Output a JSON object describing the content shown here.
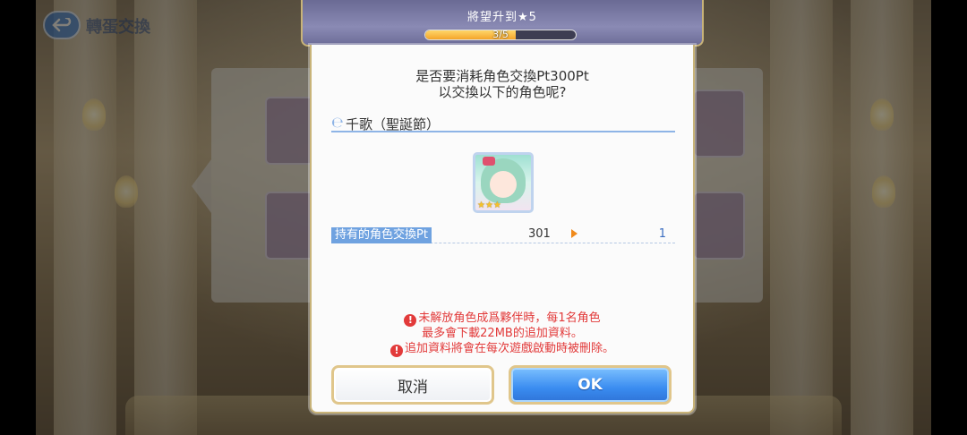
{
  "header": {
    "title": "將望升到★5",
    "progress_text": "3/5",
    "progress_value": 0.6
  },
  "background": {
    "screen_title": "轉蛋交換"
  },
  "dialog": {
    "question_line1": "是否要消耗角色交換Pt300Pt",
    "question_line2": "以交換以下的角色呢?",
    "character_name": "千歌（聖誕節）",
    "portrait_stars": "★★★",
    "pt_label": "持有的角色交換Pt",
    "pt_current": "301",
    "pt_after": "1",
    "warning1_line1": "未解放角色成爲夥伴時，每1名角色",
    "warning1_line2": "最多會下載22MB的追加資料。",
    "warning2": "追加資料將會在每次遊戲啟動時被刪除。",
    "warn_symbol": "!",
    "cancel_label": "取消",
    "ok_label": "OK"
  },
  "colors": {
    "accent_blue": "#3a8cf0",
    "warning_red": "#e23a3a",
    "progress_orange": "#f4a52a",
    "frame_gold": "#c8b378"
  }
}
